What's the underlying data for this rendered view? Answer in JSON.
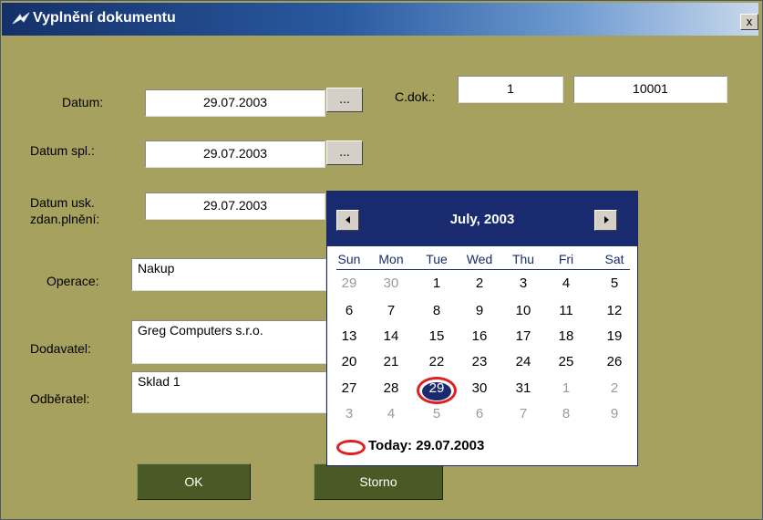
{
  "window": {
    "title": "Vyplnění dokumentu",
    "close_label": "x",
    "icon": "app-icon",
    "close_icon": "close-icon"
  },
  "form": {
    "datum_label": "Datum:",
    "datum_value": "29.07.2003",
    "datum_spl_label": "Datum spl.:",
    "datum_spl_value": "29.07.2003",
    "datum_usk_label_1": "Datum usk.",
    "datum_usk_label_2": "zdan.plnění:",
    "datum_usk_value": "29.07.2003",
    "picker_label": "...",
    "cdok_label": "C.dok.:",
    "cdok_value_1": "1",
    "cdok_value_2": "10001",
    "operace_label": "Operace:",
    "operace_value": "Nakup",
    "dodavatel_label": "Dodavatel:",
    "dodavatel_value": "Greg Computers s.r.o.",
    "odberatel_label": "Odběratel:",
    "odberatel_value": "Sklad 1"
  },
  "buttons": {
    "ok": "OK",
    "storno": "Storno"
  },
  "calendar": {
    "month_label": "July, 2003",
    "prev_icon": "triangle-left-icon",
    "next_icon": "triangle-right-icon",
    "weekdays": [
      "Sun",
      "Mon",
      "Tue",
      "Wed",
      "Thu",
      "Fri",
      "Sat"
    ],
    "weeks": [
      [
        {
          "d": "29",
          "other": true
        },
        {
          "d": "30",
          "other": true
        },
        {
          "d": "1"
        },
        {
          "d": "2"
        },
        {
          "d": "3"
        },
        {
          "d": "4"
        },
        {
          "d": "5"
        }
      ],
      [
        {
          "d": "6"
        },
        {
          "d": "7"
        },
        {
          "d": "8"
        },
        {
          "d": "9"
        },
        {
          "d": "10"
        },
        {
          "d": "11"
        },
        {
          "d": "12"
        }
      ],
      [
        {
          "d": "13"
        },
        {
          "d": "14"
        },
        {
          "d": "15"
        },
        {
          "d": "16"
        },
        {
          "d": "17"
        },
        {
          "d": "18"
        },
        {
          "d": "19"
        }
      ],
      [
        {
          "d": "20"
        },
        {
          "d": "21"
        },
        {
          "d": "22"
        },
        {
          "d": "23"
        },
        {
          "d": "24"
        },
        {
          "d": "25"
        },
        {
          "d": "26"
        }
      ],
      [
        {
          "d": "27"
        },
        {
          "d": "28"
        },
        {
          "d": "29",
          "selected": true
        },
        {
          "d": "30"
        },
        {
          "d": "31"
        },
        {
          "d": "1",
          "other": true
        },
        {
          "d": "2",
          "other": true
        }
      ],
      [
        {
          "d": "3",
          "other": true
        },
        {
          "d": "4",
          "other": true
        },
        {
          "d": "5",
          "other": true
        },
        {
          "d": "6",
          "other": true
        },
        {
          "d": "7",
          "other": true
        },
        {
          "d": "8",
          "other": true
        },
        {
          "d": "9",
          "other": true
        }
      ]
    ],
    "today_label": "Today: 29.07.2003",
    "colors": {
      "header": "#1a2a6e",
      "selected_ring": "#e02020"
    }
  }
}
